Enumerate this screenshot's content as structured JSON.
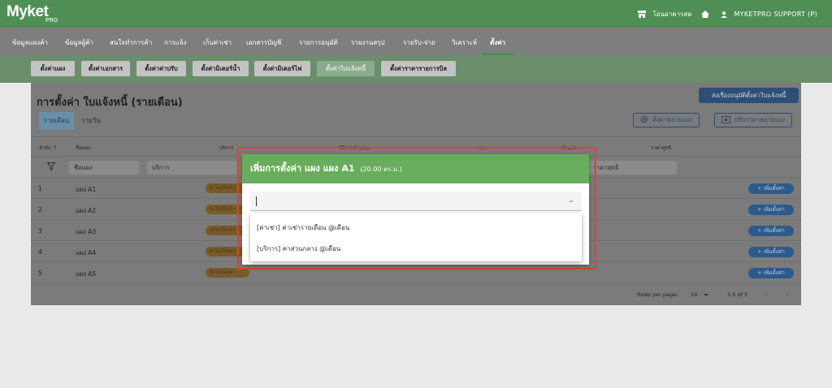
{
  "app": {
    "logo": "Myket",
    "logo_sub": "PRO",
    "building": "โอนอาคารสด",
    "user": "MYKETPRO SUPPORT (P)"
  },
  "main_nav": [
    {
      "label": "ข้อมูลแผงค้า",
      "active": false
    },
    {
      "label": "ข้อมูลผู้ค้า",
      "active": false
    },
    {
      "label": "สนใจทำการค้า",
      "active": false
    },
    {
      "label": "การแจ้ง",
      "active": false
    },
    {
      "label": "เก็บค่าเช่า",
      "active": false
    },
    {
      "label": "เอกสารบัญชี",
      "active": false
    },
    {
      "label": "รายการอนุมัติ",
      "active": false
    },
    {
      "label": "รายงานสรุป",
      "active": false
    },
    {
      "label": "รายรับ-จ่าย",
      "active": false
    },
    {
      "label": "วิเคราะห์",
      "active": false
    },
    {
      "label": "ตั้งค่า",
      "active": true
    }
  ],
  "sub_nav": [
    {
      "label": "ตั้งค่าแผง",
      "active": false
    },
    {
      "label": "ตั้งค่าเอกสาร",
      "active": false
    },
    {
      "label": "ตั้งค่าค่าปรับ",
      "active": false
    },
    {
      "label": "ตั้งค่ามิเตอร์น้ำ",
      "active": false
    },
    {
      "label": "ตั้งค่ามิเตอร์ไฟ",
      "active": false
    },
    {
      "label": "ตั้งค่าใบแจ้งหนี้",
      "active": true
    },
    {
      "label": "ตั้งค่าราคารายการบิล",
      "active": false
    }
  ],
  "page": {
    "title": "การตั้งค่า ใบแจ้งหนี้ (รายเดือน)",
    "approve_button": "ส่งเรื่องอนุมัติตั้งค่าใบแจ้งหนี้",
    "tabs": [
      {
        "label": "รายเดือน",
        "active": true
      },
      {
        "label": "รายวัน",
        "active": false
      }
    ],
    "multi_setting_button": "ตั้งค่าหลายแผง",
    "multi_price_button": "ปรับราคาหลายแผง"
  },
  "table": {
    "headers": {
      "order": "ลำดับ ↑",
      "name": "ชื่อแผง",
      "service": "บริการ",
      "calc": "วิธีการคำนวณ",
      "price": "ราคา",
      "discount": "ส่วนลด",
      "net": "ราคาสุทธิ"
    },
    "filters": {
      "name": "ชื่อแผง",
      "service": "บริการ",
      "net": "ราคาสุทธิ"
    },
    "rows": [
      {
        "no": "1",
        "name": "แผง A1",
        "status": "ยังไม่มีตั้งค่า",
        "action": "+ เพิ่มตั้งค่า"
      },
      {
        "no": "2",
        "name": "แผง A2",
        "status": "ยังไม่มีตั้งค่า",
        "action": "+ เพิ่มตั้งค่า"
      },
      {
        "no": "3",
        "name": "แผง A3",
        "status": "ยังไม่มีตั้งค่า",
        "action": "+ เพิ่มตั้งค่า"
      },
      {
        "no": "4",
        "name": "แผง A4",
        "status": "ยังไม่มีตั้งค่า",
        "action": "+ เพิ่มตั้งค่า"
      },
      {
        "no": "5",
        "name": "แผง A5",
        "status": "ยังไม่มีตั้งค่า",
        "action": "+ เพิ่มตั้งค่า"
      }
    ],
    "pagination": {
      "rows_label": "Rows per page:",
      "rows_value": "10",
      "range": "1-5 of 5"
    }
  },
  "modal": {
    "title": "เพิ่มการตั้งค่า แผง แผง A1",
    "area": "(20.00 ตร.ม.)",
    "input_value": "",
    "options": [
      "[ค่าเช่า] ค่าเช่ารายเดือน @เดือน",
      "[บริการ] ค่าส่วนกลาง @เดือน"
    ]
  }
}
